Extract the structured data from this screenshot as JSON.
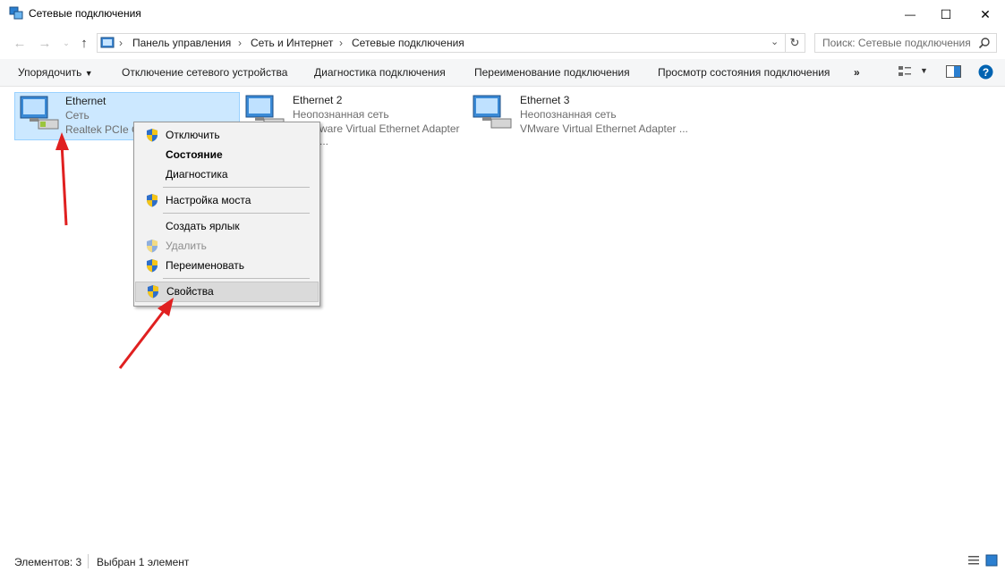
{
  "window": {
    "title": "Сетевые подключения",
    "minimize_glyph": "—",
    "maximize_glyph": "☐",
    "close_glyph": "✕"
  },
  "address": {
    "crumbs": [
      "Панель управления",
      "Сеть и Интернет",
      "Сетевые подключения"
    ],
    "separator": "›"
  },
  "search": {
    "placeholder": "Поиск: Сетевые подключения"
  },
  "toolbar": {
    "organize": "Упорядочить",
    "items": [
      "Отключение сетевого устройства",
      "Диагностика подключения",
      "Переименование подключения",
      "Просмотр состояния подключения"
    ],
    "more": "»"
  },
  "connections": [
    {
      "name": "Ethernet",
      "status": "Сеть",
      "adapter": "Realtek PCIe G"
    },
    {
      "name": "Ethernet 2",
      "status": "Неопознанная сеть",
      "adapter": "ware Virtual Ethernet Adapter ..."
    },
    {
      "name": "Ethernet 3",
      "status": "Неопознанная сеть",
      "adapter": "VMware Virtual Ethernet Adapter ..."
    }
  ],
  "context_menu": [
    {
      "label": "Отключить",
      "shield": true
    },
    {
      "label": "Состояние",
      "bold": true
    },
    {
      "label": "Диагностика"
    },
    {
      "label": "Настройка моста",
      "shield": true
    },
    {
      "label": "Создать ярлык"
    },
    {
      "label": "Удалить",
      "shield": true,
      "disabled": true
    },
    {
      "label": "Переименовать",
      "shield": true
    },
    {
      "label": "Свойства",
      "shield": true,
      "highlighted": true
    }
  ],
  "status_bar": {
    "count": "Элементов: 3",
    "selected": "Выбран 1 элемент"
  },
  "colors": {
    "selection": "#cce8ff",
    "annotation_arrow": "#e02020",
    "help": "#0063b1"
  }
}
